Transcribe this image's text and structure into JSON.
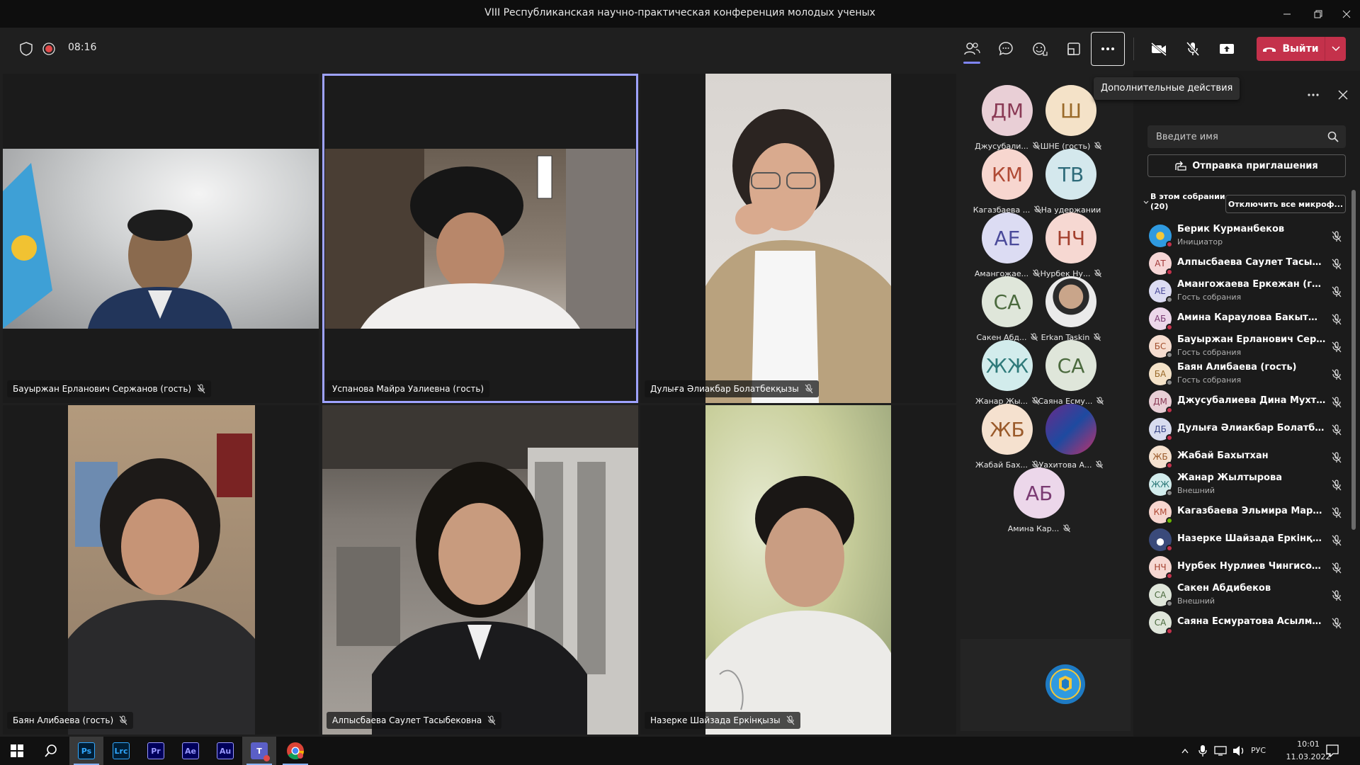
{
  "window": {
    "title": "VIII Республиканская научно-практическая конференция молодых ученых"
  },
  "header": {
    "timer": "08:16",
    "leave_label": "Выйти",
    "tooltip": "Дополнительные действия"
  },
  "colors": {
    "accent": "#7f85f5",
    "leave": "#c4314b",
    "recording": "#e04a4a",
    "speaking_outline": "#9ea2ff"
  },
  "tiles": [
    {
      "name": "Бауыржан Ерланович Сержанов (гость)"
    },
    {
      "name": "Успанова Майра Уалиевна (гость)"
    },
    {
      "name": "Дулыға Әлиакбар Болатбекқызы"
    },
    {
      "name": "Баян Алибаева (гость)"
    },
    {
      "name": "Алпысбаева Саулет Тасыбековна"
    },
    {
      "name": "Назерке Шайзада Еркінқызы"
    }
  ],
  "gallery": [
    {
      "initials": "ДМ",
      "label": "Джусубали..."
    },
    {
      "initials": "Ш",
      "label": "ШНЕ (гость)"
    },
    {
      "initials": "КМ",
      "label": "Кагазбаева ..."
    },
    {
      "initials": "ТВ",
      "label": "На удержании"
    },
    {
      "initials": "АЕ",
      "label": "Амангожае..."
    },
    {
      "initials": "НЧ",
      "label": "Нурбек Ну..."
    },
    {
      "initials": "СА",
      "label": "Сакен Абд..."
    },
    {
      "initials": "",
      "label": "Erkan Taskin"
    },
    {
      "initials": "ЖЖ",
      "label": "Жанар Жы..."
    },
    {
      "initials": "СА",
      "label": "Саяна Есму..."
    },
    {
      "initials": "ЖБ",
      "label": "Жабай Бах..."
    },
    {
      "initials": "",
      "label": "Уахитова А..."
    },
    {
      "initials": "АБ",
      "label": "Амина Кар..."
    }
  ],
  "panel": {
    "search_placeholder": "Введите имя",
    "invite_label": "Отправка приглашения",
    "section_label": "В этом собрании (20)",
    "mute_all_label": "Отключить все микроф..."
  },
  "participants": [
    {
      "initials": "",
      "name": "Берик Курманбеков",
      "role": "Инициатор"
    },
    {
      "initials": "АТ",
      "name": "Алпысбаева Саулет Тасыбековна",
      "role": ""
    },
    {
      "initials": "АЕ",
      "name": "Амангожаева Еркежан (гость)",
      "role": "Гость собрания"
    },
    {
      "initials": "АБ",
      "name": "Амина Караулова Бакытжановна",
      "role": ""
    },
    {
      "initials": "БС",
      "name": "Бауыржан Ерланович Сержанов",
      "role": "Гость собрания"
    },
    {
      "initials": "БА",
      "name": "Баян Алибаева (гость)",
      "role": "Гость собрания"
    },
    {
      "initials": "ДМ",
      "name": "Джусубалиева Дина Мухтаховна",
      "role": ""
    },
    {
      "initials": "ДБ",
      "name": "Дулыға Әлиакбар Болатбекқызы",
      "role": ""
    },
    {
      "initials": "ЖБ",
      "name": "Жабай Бахытхан",
      "role": ""
    },
    {
      "initials": "ЖЖ",
      "name": "Жанар Жылтырова",
      "role": "Внешний"
    },
    {
      "initials": "КМ",
      "name": "Кагазбаева Эльмира Маратовна",
      "role": ""
    },
    {
      "initials": "",
      "name": "Назерке Шайзада Еркінқызы",
      "role": ""
    },
    {
      "initials": "НЧ",
      "name": "Нурбек Нурлиев Чингисович",
      "role": ""
    },
    {
      "initials": "СА",
      "name": "Сакен Абдибеков",
      "role": "Внешний"
    },
    {
      "initials": "СА",
      "name": "Саяна Есмуратова Асылмураткызы",
      "role": ""
    }
  ],
  "taskbar": {
    "apps": [
      {
        "name": "Ps",
        "color": "#31a8ff",
        "bg": "#001e36"
      },
      {
        "name": "Lrc",
        "color": "#31a8ff",
        "bg": "#001e36"
      },
      {
        "name": "Pr",
        "color": "#9999ff",
        "bg": "#00005b"
      },
      {
        "name": "Ae",
        "color": "#9999ff",
        "bg": "#00005b"
      },
      {
        "name": "Au",
        "color": "#9999ff",
        "bg": "#00005b"
      }
    ],
    "lang": "РУС",
    "time": "10:01",
    "date": "11.03.2022"
  }
}
